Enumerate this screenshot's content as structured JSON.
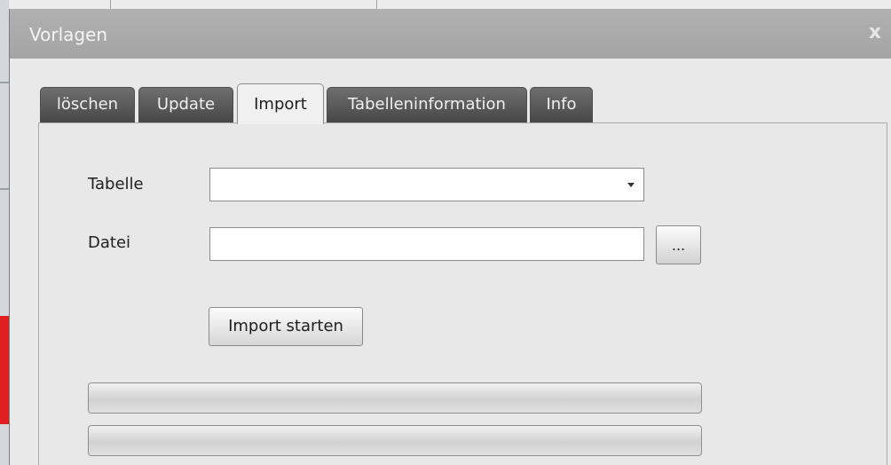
{
  "window": {
    "title": "Vorlagen",
    "close_symbol": "x"
  },
  "tabs": [
    {
      "label": "löschen",
      "active": false
    },
    {
      "label": "Update",
      "active": false
    },
    {
      "label": "Import",
      "active": true
    },
    {
      "label": "Tabelleninformation",
      "active": false
    },
    {
      "label": "Info",
      "active": false
    }
  ],
  "import_form": {
    "table_label": "Tabelle",
    "table_value": "",
    "file_label": "Datei",
    "file_value": "",
    "browse_label": "...",
    "start_label": "Import starten"
  },
  "progress_bars": [
    {
      "value": 0
    },
    {
      "value": 0
    }
  ],
  "colors": {
    "titlebar": "#a9a9a9",
    "dialog_bg": "#e9e9e9",
    "tab_inactive": "#5a5a5a",
    "tab_active": "#f0f0f0"
  },
  "icons": {
    "close": "close-icon",
    "dropdown": "chevron-down-icon"
  }
}
